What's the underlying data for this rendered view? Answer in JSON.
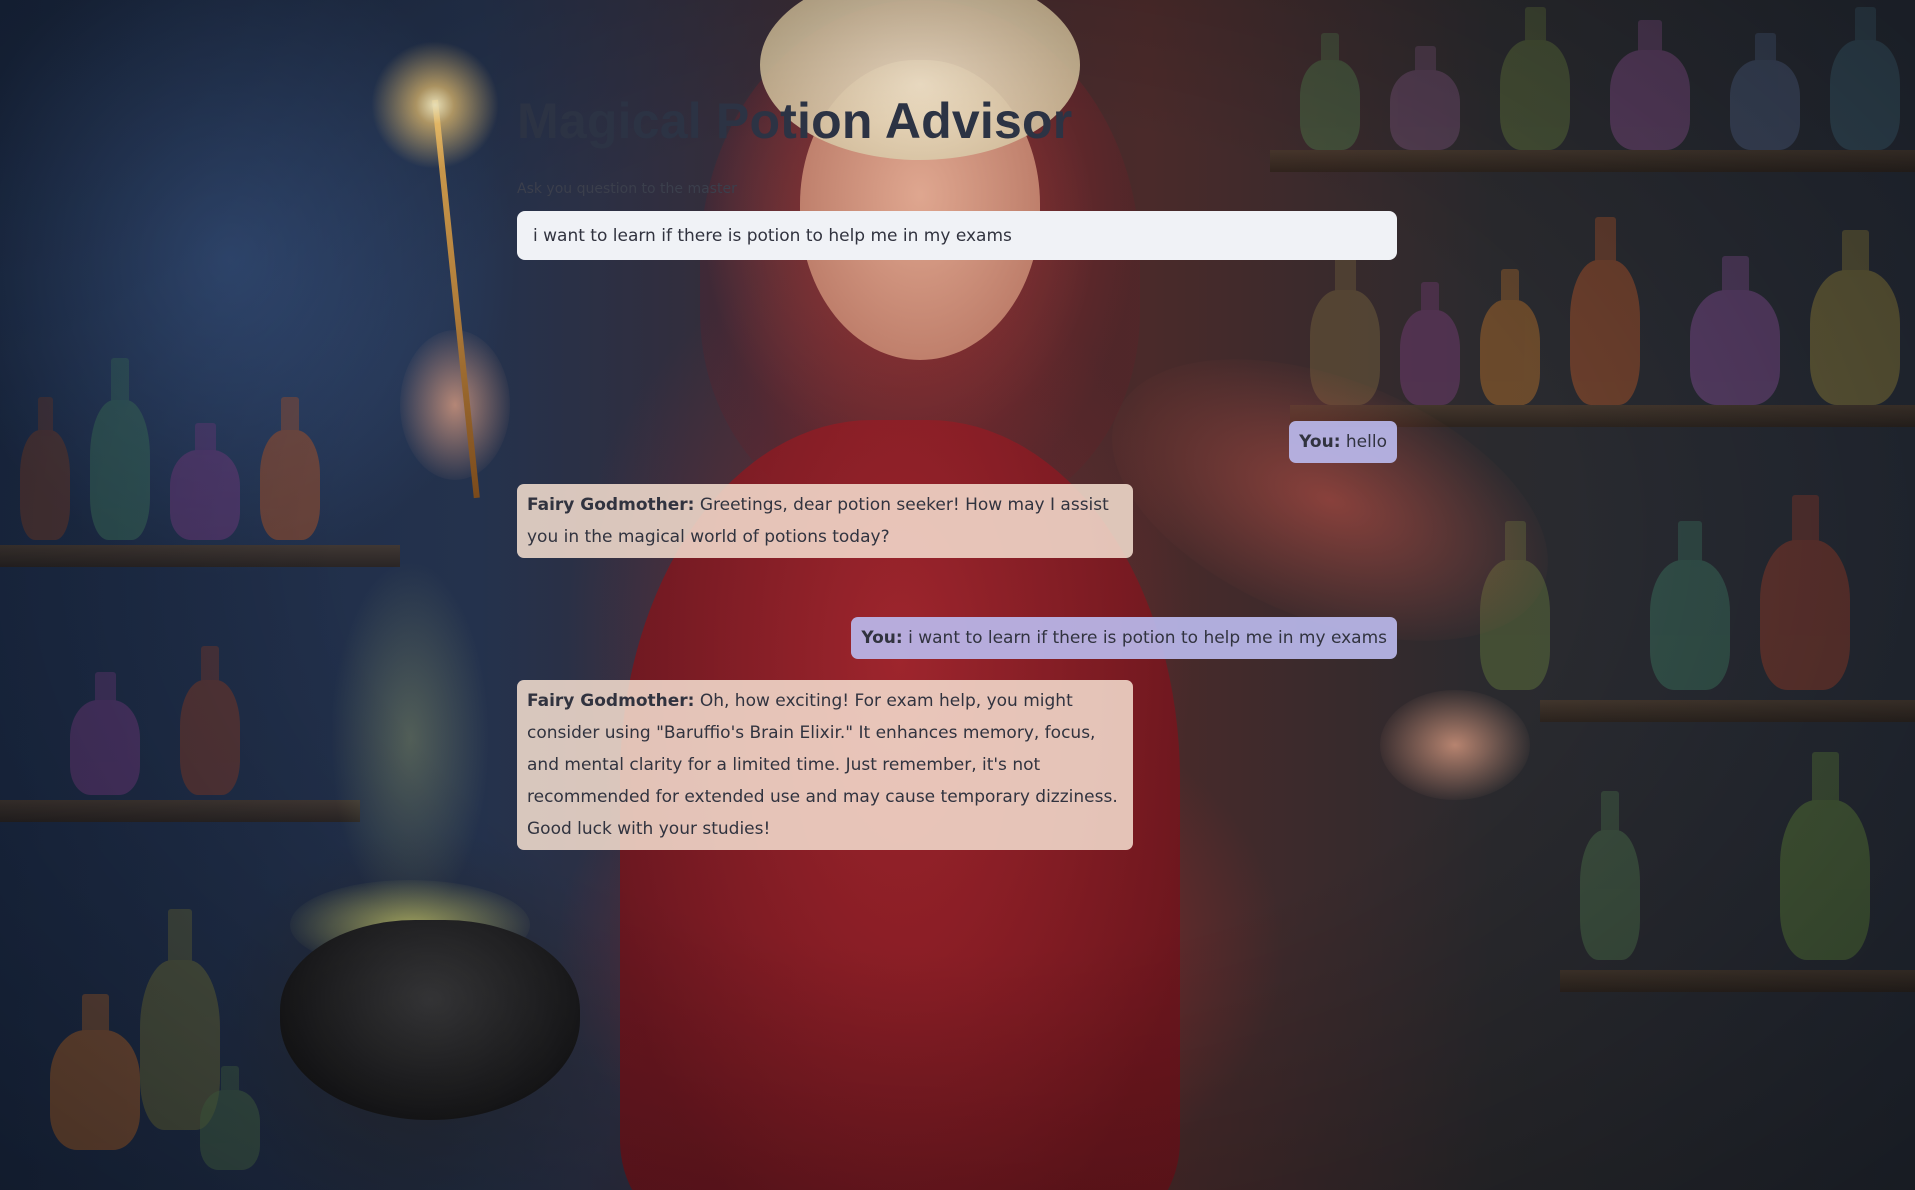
{
  "app": {
    "title": "Magical Potion Advisor",
    "subtitle": "Ask you question to the master"
  },
  "input": {
    "value": "i want to learn if there is potion to help me in my exams",
    "placeholder": ""
  },
  "messages": [
    {
      "role": "user",
      "speaker": "You:",
      "text": "hello"
    },
    {
      "role": "bot",
      "speaker": "Fairy Godmother:",
      "text": "Greetings, dear potion seeker! How may I assist you in the magical world of potions today?"
    },
    {
      "role": "user",
      "speaker": "You:",
      "text": "i want to learn if there is potion to help me in my exams"
    },
    {
      "role": "bot",
      "speaker": "Fairy Godmother:",
      "text": "Oh, how exciting! For exam help, you might consider using \"Baruffio's Brain Elixir.\" It enhances memory, focus, and mental clarity for a limited time. Just remember, it's not recommended for extended use and may cause temporary dizziness. Good luck with your studies!"
    }
  ],
  "colors": {
    "title": "#2c3344",
    "input_bg": "#f0f2f6",
    "user_bubble": "#bab8ec",
    "bot_bubble": "#f6e0d0"
  }
}
